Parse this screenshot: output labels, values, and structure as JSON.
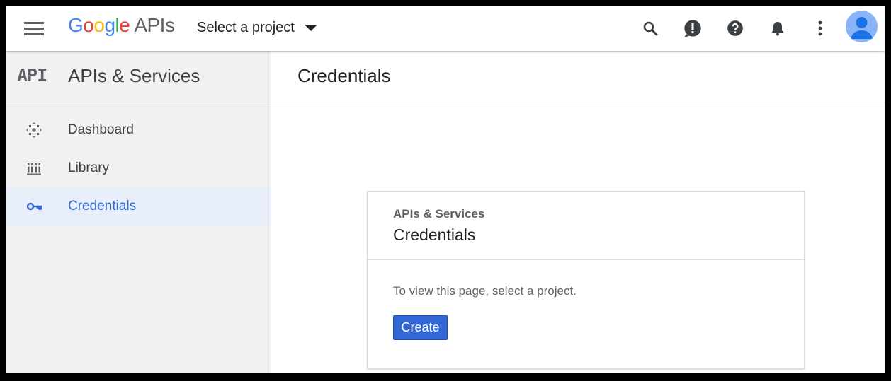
{
  "topbar": {
    "logo_google": [
      "G",
      "o",
      "o",
      "g",
      "l",
      "e"
    ],
    "logo_product": "APIs",
    "project_select_label": "Select a project",
    "icons": [
      "menu-icon",
      "search-icon",
      "feedback-icon",
      "help-icon",
      "notifications-icon",
      "more-vert-icon",
      "account-avatar"
    ]
  },
  "sidebar": {
    "api_logo": "API",
    "title": "APIs & Services",
    "items": [
      {
        "label": "Dashboard",
        "icon": "dashboard-icon",
        "active": false
      },
      {
        "label": "Library",
        "icon": "library-icon",
        "active": false
      },
      {
        "label": "Credentials",
        "icon": "key-icon",
        "active": true
      }
    ]
  },
  "main": {
    "title": "Credentials",
    "card": {
      "subtitle": "APIs & Services",
      "title": "Credentials",
      "message": "To view this page, select a project.",
      "create_label": "Create"
    }
  },
  "colors": {
    "accent": "#3367d6",
    "sidebar_bg": "#f1f1f1",
    "active_bg": "#e8eef9"
  }
}
